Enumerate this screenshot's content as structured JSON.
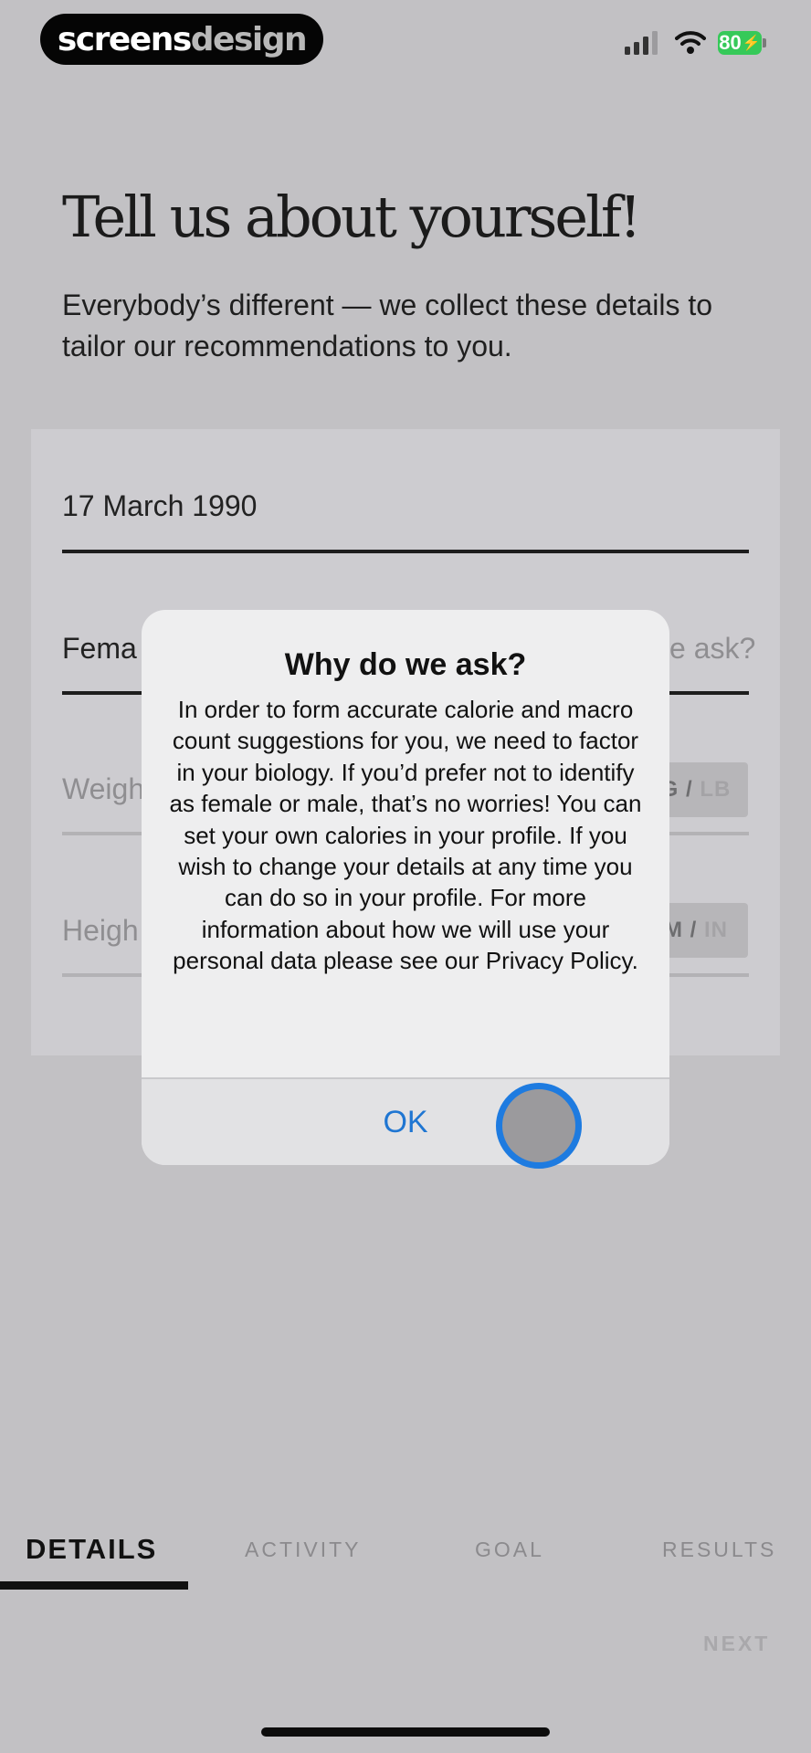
{
  "status_bar": {
    "brand_part1": "screens",
    "brand_part2": "design",
    "battery": "80"
  },
  "header": {
    "title": "Tell us about yourself!",
    "subtitle": "Everybody’s different — we collect these details to tailor our recommendations to you."
  },
  "form": {
    "birthdate_value": "17 March 1990",
    "gender_value_visible": "Fema",
    "why_ask_visible": "e ask?",
    "weight_placeholder_visible": "Weigh",
    "weight_unit_active": "G /",
    "weight_unit_inactive": "LB",
    "height_placeholder_visible": "Heigh",
    "height_unit_active": "M /",
    "height_unit_inactive": "IN"
  },
  "dialog": {
    "title": "Why do we ask?",
    "body": "In order to form accurate calorie and macro count suggestions for you, we need to factor in your biology. If you’d prefer not to identify as female or male, that’s no worries! You can set your own calories in your profile.  If you wish to change your details at any time you can do so in your profile.  For more information about how we will use your personal data please see our Privacy Policy.",
    "ok_label": "OK"
  },
  "tabs": [
    {
      "label": "DETAILS",
      "active": true
    },
    {
      "label": "ACTIVITY",
      "active": false
    },
    {
      "label": "GOAL",
      "active": false
    },
    {
      "label": "RESULTS",
      "active": false
    }
  ],
  "footer": {
    "next_label": "NEXT"
  },
  "colors": {
    "overlay_bg": "#c2c1c4",
    "accent_blue": "#1f76d2",
    "battery_green": "#36c959"
  }
}
